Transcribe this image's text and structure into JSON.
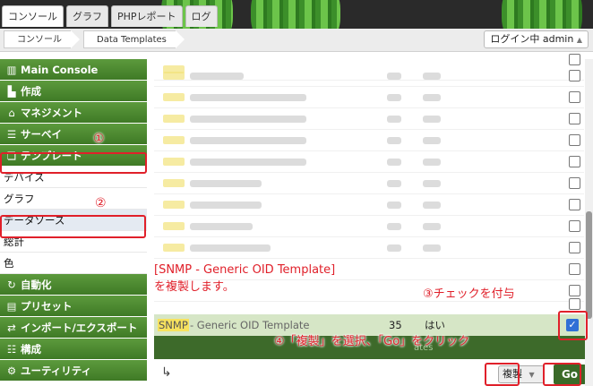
{
  "tabs": [
    "コンソール",
    "グラフ",
    "PHPレポート",
    "ログ"
  ],
  "breadcrumb": [
    "コンソール",
    "Data Templates"
  ],
  "login": {
    "label": "ログイン中 admin",
    "caret": "▲"
  },
  "sidebar": {
    "categories_top": [
      {
        "icon": "map-icon",
        "glyph": "▥",
        "label": "Main Console"
      },
      {
        "icon": "chart-icon",
        "glyph": "▙",
        "label": "作成"
      },
      {
        "icon": "home-icon",
        "glyph": "⌂",
        "label": "マネジメント"
      },
      {
        "icon": "database-icon",
        "glyph": "☰",
        "label": "サーベイ"
      },
      {
        "icon": "template-icon",
        "glyph": "❏",
        "label": "テンプレート"
      }
    ],
    "subitems": [
      "デバイス",
      "グラフ",
      "データソース",
      "総計",
      "色"
    ],
    "categories_bottom": [
      {
        "icon": "refresh-icon",
        "glyph": "↻",
        "label": "自動化"
      },
      {
        "icon": "preset-icon",
        "glyph": "▤",
        "label": "プリセット"
      },
      {
        "icon": "import-export-icon",
        "glyph": "⇄",
        "label": "インポート/エクスポート"
      },
      {
        "icon": "sliders-icon",
        "glyph": "☷",
        "label": "構成"
      },
      {
        "icon": "tools-icon",
        "glyph": "⚙",
        "label": "ユーティリティ"
      }
    ]
  },
  "table": {
    "selected_row": {
      "tag": "SNMP",
      "name": " - Generic OID Template",
      "count": "35",
      "in_use": "はい",
      "checked": true
    }
  },
  "footer": {
    "faint_label": "ates",
    "action_value": "複製",
    "action_caret": "▼",
    "go_label": "Go",
    "corner": "↳"
  },
  "annotations": {
    "step1": "①",
    "step2": "②",
    "step3": "③チェックを付与",
    "step4": "④「複製」を選択、「Go」をクリック",
    "note_line1": "[SNMP - Generic OID Template]",
    "note_line2": "を複製します。"
  },
  "colors": {
    "accent_green": "#3f7a26",
    "annotation_red": "#e0202a",
    "highlight_yellow": "#f7e25e"
  }
}
